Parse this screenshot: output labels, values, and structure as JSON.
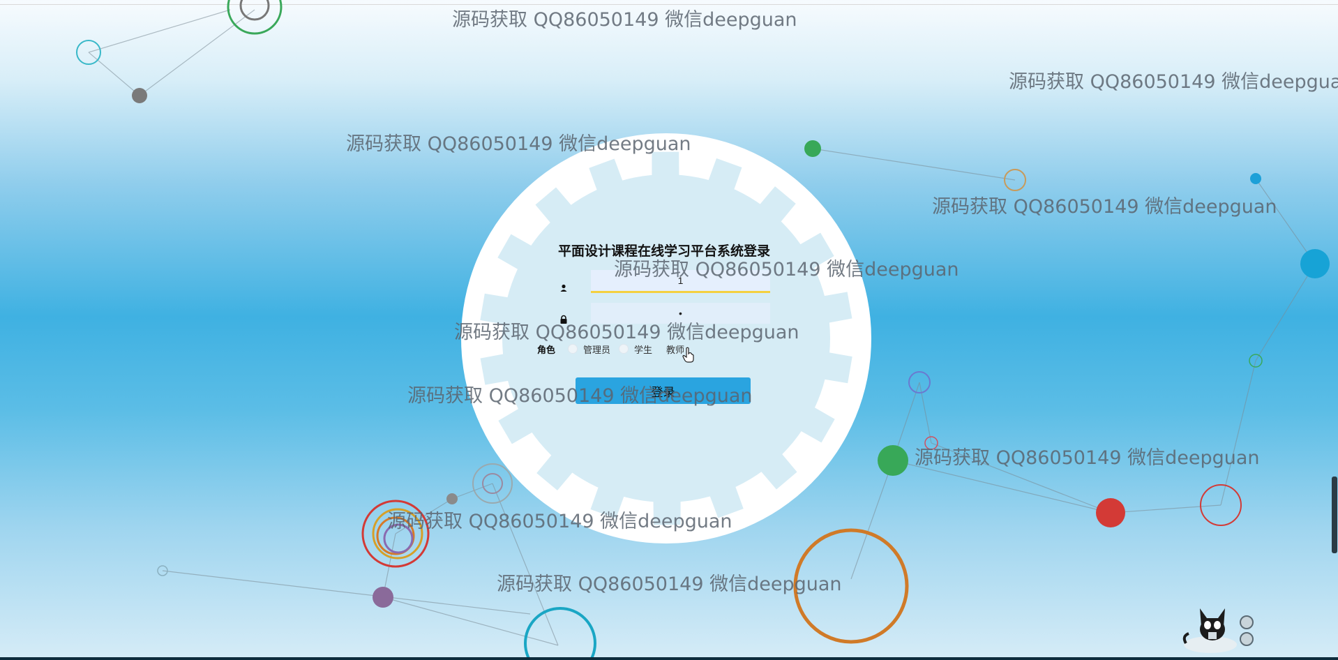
{
  "login": {
    "title": "平面设计课程在线学习平台系统登录",
    "username_value": "1",
    "password_value": "•",
    "role_label": "角色",
    "roles": [
      "管理员",
      "学生",
      "教师"
    ],
    "submit_label": "登录"
  },
  "watermark_text": "源码获取 QQ86050149 微信deepguan",
  "colors": {
    "button": "#2aa4e0",
    "focus_underline": "#f4d03f",
    "background_mid": "#3fb1e2"
  }
}
